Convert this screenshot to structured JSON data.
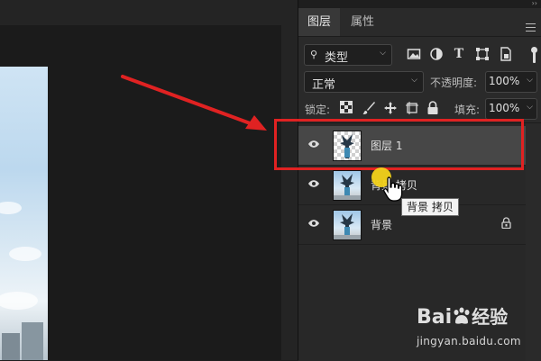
{
  "panel": {
    "tabs": [
      {
        "label": "图层"
      },
      {
        "label": "属性"
      }
    ],
    "filter": {
      "label": "类型"
    },
    "blend": {
      "mode": "正常",
      "opacity_label": "不透明度:",
      "opacity_value": "100%"
    },
    "lock": {
      "label": "锁定:",
      "fill_label": "填充:",
      "fill_value": "100%"
    },
    "layers": [
      {
        "name": "图层 1",
        "thumb": "transparent",
        "selected": true
      },
      {
        "name": "背景 拷贝",
        "thumb": "photo",
        "selected": false
      },
      {
        "name": "背景",
        "thumb": "photo",
        "selected": false,
        "locked": true
      }
    ]
  },
  "tooltip": {
    "text": "背景 拷贝"
  },
  "watermark": {
    "brand": "Bai",
    "brand_cn": "经验",
    "url": "jingyan.baidu.com"
  },
  "colors": {
    "highlight": "#e02222",
    "cursor": "#f3d21a",
    "panel_bg": "#2a2a2a",
    "selected_row": "#474747"
  },
  "icons": [
    "search-icon",
    "image-filter-icon",
    "adjustment-filter-icon",
    "text-filter-icon",
    "shape-filter-icon",
    "smart-object-filter-icon",
    "lock-transparent-icon",
    "lock-paint-icon",
    "lock-move-icon",
    "lock-artboard-icon",
    "lock-all-icon",
    "eye-icon",
    "layer-lock-icon",
    "hand-cursor-icon",
    "panel-menu-icon"
  ]
}
